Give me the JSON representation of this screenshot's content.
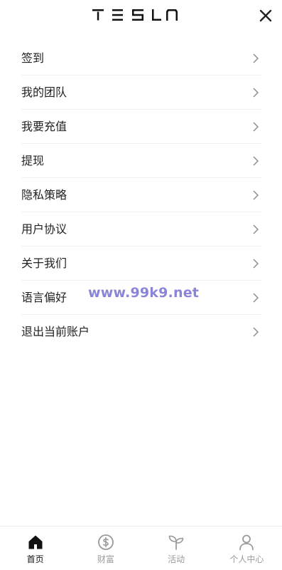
{
  "header": {
    "logo": "TESLA",
    "close_icon": "close-icon"
  },
  "menu": {
    "items": [
      {
        "label": "签到"
      },
      {
        "label": "我的团队"
      },
      {
        "label": "我要充值"
      },
      {
        "label": "提现"
      },
      {
        "label": "隐私策略"
      },
      {
        "label": "用户协议"
      },
      {
        "label": "关于我们"
      },
      {
        "label": "语言偏好"
      },
      {
        "label": "退出当前账户"
      }
    ]
  },
  "watermark": "www.99k9.net",
  "tabbar": {
    "tabs": [
      {
        "label": "首页",
        "icon": "home-icon",
        "active": true
      },
      {
        "label": "财富",
        "icon": "dollar-icon",
        "active": false
      },
      {
        "label": "活动",
        "icon": "sprout-icon",
        "active": false
      },
      {
        "label": "个人中心",
        "icon": "user-icon",
        "active": false
      }
    ]
  },
  "colors": {
    "active": "#111111",
    "inactive": "#9a9a9a",
    "watermark": "#8a85d6"
  }
}
